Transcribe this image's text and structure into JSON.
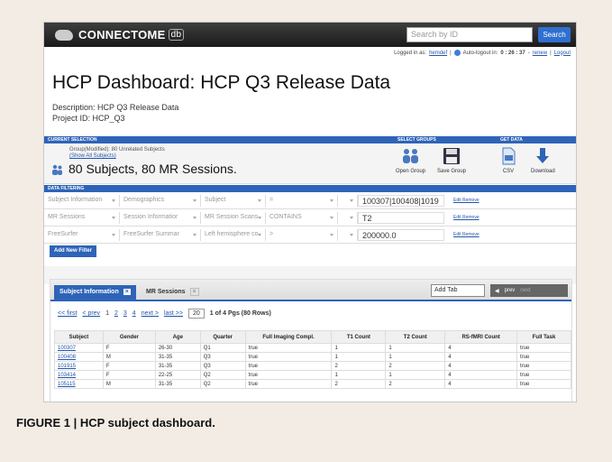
{
  "header": {
    "logo_text": "CONNECTOME",
    "logo_badge": "db",
    "search_placeholder": "Search by ID",
    "search_button": "Search"
  },
  "login": {
    "logged_in_label": "Logged in as:",
    "user": "hemdef",
    "autologout_label": "Auto-logout in:",
    "timer": "0 : 26 : 37",
    "renew": "renew",
    "logout": "Logout"
  },
  "page": {
    "title": "HCP Dashboard: HCP Q3 Release Data",
    "description": "Description: HCP Q3 Release Data",
    "project_id": "Project ID: HCP_Q3"
  },
  "sections": {
    "current_selection": "CURRENT SELECTION",
    "select_groups": "SELECT GROUPS",
    "get_data": "GET DATA",
    "data_filtering": "DATA FILTERING"
  },
  "selection": {
    "group_line": "Group(Modified): 80 Unrelated Subjects",
    "show_all": "(Show All Subjects)",
    "summary": "80 Subjects, 80 MR Sessions."
  },
  "actions": {
    "open_group": "Open Group",
    "save_group": "Save Group",
    "csv": "CSV",
    "download": "Download"
  },
  "filters": [
    {
      "cat": "Subject Information",
      "sub": "Demographics",
      "field": "Subject",
      "op": "=",
      "op2": "",
      "value": "100307|100408|1019",
      "remove": "Edit Remove"
    },
    {
      "cat": "MR Sessions",
      "sub": "Session Informatior",
      "field": "MR Session Scans",
      "op": "CONTAINS",
      "op2": "",
      "value": "T2",
      "remove": "Edit Remove"
    },
    {
      "cat": "FreeSurfer",
      "sub": "FreeSurfer Summar",
      "field": "Left hemisphere co",
      "op": ">",
      "op2": "",
      "value": "200000.0",
      "remove": "Edit Remove"
    }
  ],
  "add_filter": "Add New Filter",
  "tabs": {
    "tab1": "Subject Information",
    "tab2": "MR Sessions",
    "add_tab": "Add Tab",
    "prev": "prev",
    "next": "next"
  },
  "pager": {
    "first": "<< first",
    "prev": "< prev",
    "p1": "1",
    "p2": "2",
    "p3": "3",
    "p4": "4",
    "next": "next >",
    "last": "last >>",
    "per_page": "20",
    "info": "1 of 4 Pgs (80 Rows)"
  },
  "table": {
    "headers": [
      "Subject",
      "Gender",
      "Age",
      "Quarter",
      "Full Imaging Compl.",
      "T1 Count",
      "T2 Count",
      "RS-fMRI Count",
      "Full Task"
    ],
    "rows": [
      [
        "100307",
        "F",
        "26-30",
        "Q1",
        "true",
        "1",
        "1",
        "4",
        "true"
      ],
      [
        "100408",
        "M",
        "31-35",
        "Q3",
        "true",
        "1",
        "1",
        "4",
        "true"
      ],
      [
        "101915",
        "F",
        "31-35",
        "Q3",
        "true",
        "2",
        "2",
        "4",
        "true"
      ],
      [
        "103414",
        "F",
        "22-25",
        "Q2",
        "true",
        "1",
        "1",
        "4",
        "true"
      ],
      [
        "105115",
        "M",
        "31-35",
        "Q2",
        "true",
        "2",
        "2",
        "4",
        "true"
      ]
    ]
  },
  "caption": "FIGURE 1 | HCP subject dashboard."
}
